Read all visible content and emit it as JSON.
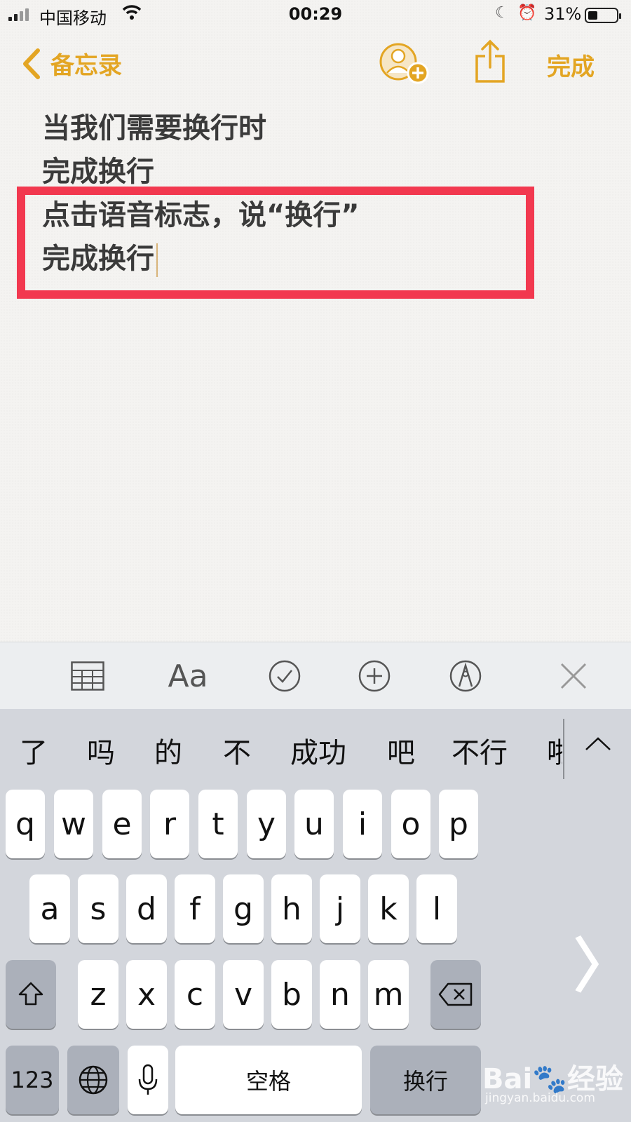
{
  "status_bar": {
    "carrier": "中国移动",
    "time": "00:29",
    "battery_percent": "31%",
    "battery_level": 0.31,
    "icons": [
      "signal-icon",
      "wifi-icon",
      "moon-icon",
      "alarm-icon",
      "battery-icon"
    ]
  },
  "nav": {
    "back_label": "备忘录",
    "done_label": "完成",
    "accent_color": "#e3a523",
    "icons": [
      "back-chevron-icon",
      "add-person-icon",
      "share-icon"
    ]
  },
  "note": {
    "lines": [
      "当我们需要换行时",
      "完成换行",
      "点击语音标志，说“换行”",
      "完成换行"
    ],
    "highlight_color": "#f2384f"
  },
  "toolbar": {
    "format_label": "Aa",
    "icons": [
      "table-icon",
      "format-icon",
      "checklist-icon",
      "plus-circle-icon",
      "markup-pen-icon",
      "close-icon"
    ]
  },
  "keyboard": {
    "candidates": [
      "了",
      "吗",
      "的",
      "不",
      "成功",
      "吧",
      "不行",
      "啦"
    ],
    "row1": [
      "q",
      "w",
      "e",
      "r",
      "t",
      "y",
      "u",
      "i",
      "o",
      "p"
    ],
    "row2": [
      "a",
      "s",
      "d",
      "f",
      "g",
      "h",
      "j",
      "k",
      "l"
    ],
    "row3": [
      "z",
      "x",
      "c",
      "v",
      "b",
      "n",
      "m"
    ],
    "numbers_label": "123",
    "space_label": "空格",
    "return_label": "换行",
    "icons": [
      "shift-icon",
      "delete-icon",
      "globe-icon",
      "mic-icon",
      "expand-candidates-icon",
      "next-page-chevron-icon"
    ]
  },
  "watermark": {
    "brand": "Bai",
    "suffix": "经验",
    "url": "jingyan.baidu.com"
  }
}
